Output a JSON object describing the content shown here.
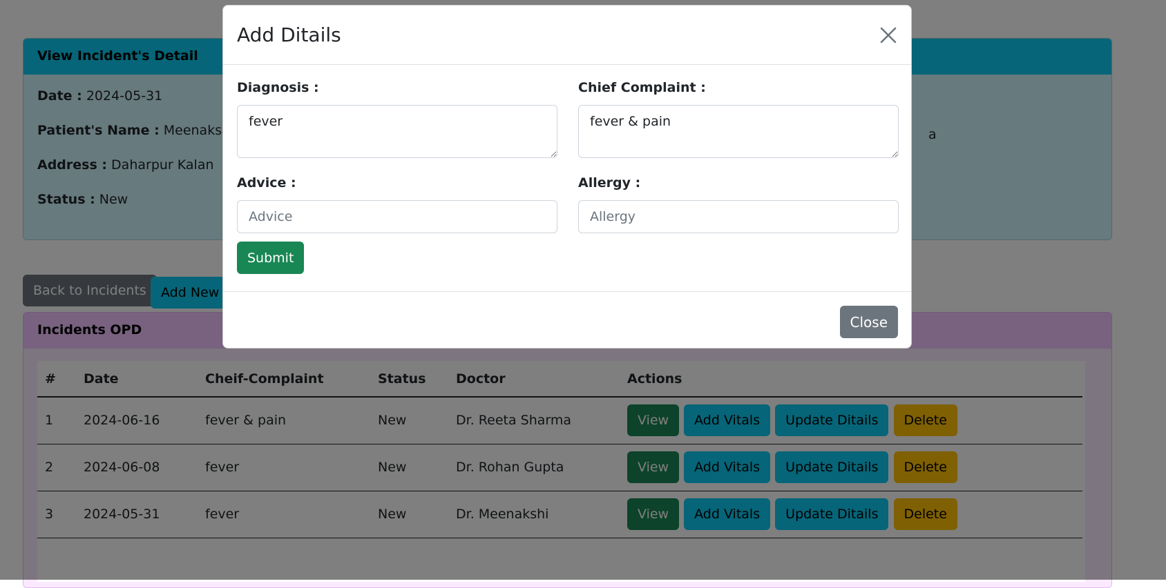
{
  "incident_card": {
    "title": "View Incident's Detail",
    "date_label": "Date :",
    "date_value": "2024-05-31",
    "patient_label": "Patient's Name :",
    "patient_value": "Meenakshi S",
    "address_label": "Address :",
    "address_value": "Daharpur Kalan",
    "status_label": "Status :",
    "status_value": "New",
    "right_cut_text": "a"
  },
  "actions_bar": {
    "back_label": "Back to Incidents",
    "add_new_label": "Add New"
  },
  "opd_card": {
    "title": "Incidents OPD",
    "columns": [
      "#",
      "Date",
      "Cheif-Complaint",
      "Status",
      "Doctor",
      "Actions"
    ],
    "rows": [
      {
        "num": "1",
        "date": "2024-06-16",
        "complaint": "fever & pain",
        "status": "New",
        "doctor": "Dr. Reeta Sharma"
      },
      {
        "num": "2",
        "date": "2024-06-08",
        "complaint": "fever",
        "status": "New",
        "doctor": "Dr. Rohan Gupta"
      },
      {
        "num": "3",
        "date": "2024-05-31",
        "complaint": "fever",
        "status": "New",
        "doctor": "Dr. Meenakshi"
      }
    ],
    "row_actions": {
      "view": "View",
      "add_vitals": "Add Vitals",
      "update_details": "Update Ditails",
      "delete": "Delete"
    }
  },
  "modal": {
    "title": "Add Ditails",
    "diagnosis_label": "Diagnosis :",
    "diagnosis_value": "fever",
    "complaint_label": "Chief Complaint :",
    "complaint_value": "fever & pain",
    "advice_label": "Advice :",
    "advice_placeholder": "Advice",
    "allergy_label": "Allergy :",
    "allergy_placeholder": "Allergy",
    "submit_label": "Submit",
    "close_label": "Close"
  },
  "colors": {
    "info": "#0dcaf0",
    "success": "#198754",
    "warning": "#ffc107",
    "secondary": "#6c757d"
  }
}
